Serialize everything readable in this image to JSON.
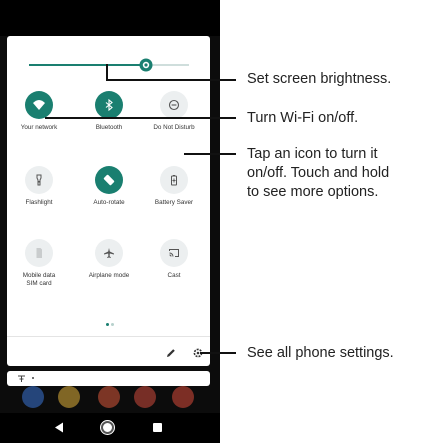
{
  "quick_settings": {
    "tiles": [
      {
        "label": "Your network",
        "icon": "wifi-icon",
        "state": "on"
      },
      {
        "label": "Bluetooth",
        "icon": "bluetooth-icon",
        "state": "on"
      },
      {
        "label": "Do Not Disturb",
        "icon": "do-not-disturb-icon",
        "state": "off"
      },
      {
        "label": "Flashlight",
        "icon": "flashlight-icon",
        "state": "off"
      },
      {
        "label": "Auto-rotate",
        "icon": "auto-rotate-icon",
        "state": "on"
      },
      {
        "label": "Battery Saver",
        "icon": "battery-saver-icon",
        "state": "off"
      },
      {
        "label": "Mobile data\nSIM card",
        "icon": "sim-card-icon",
        "state": "off"
      },
      {
        "label": "Airplane mode",
        "icon": "airplane-icon",
        "state": "off"
      },
      {
        "label": "Cast",
        "icon": "cast-icon",
        "state": "off"
      }
    ],
    "brightness_level": 0.73,
    "page_dots": 2,
    "active_page": 1
  },
  "callouts": {
    "brightness": "Set screen brightness.",
    "wifi": "Turn Wi-Fi on/off.",
    "tap_line1": "Tap an icon to turn it",
    "tap_line2": "on/off. Touch and hold",
    "tap_line3": "to see more options.",
    "settings": "See all phone settings."
  },
  "colors": {
    "accent": "#1a7f70",
    "tile_off": "#eceff0"
  }
}
